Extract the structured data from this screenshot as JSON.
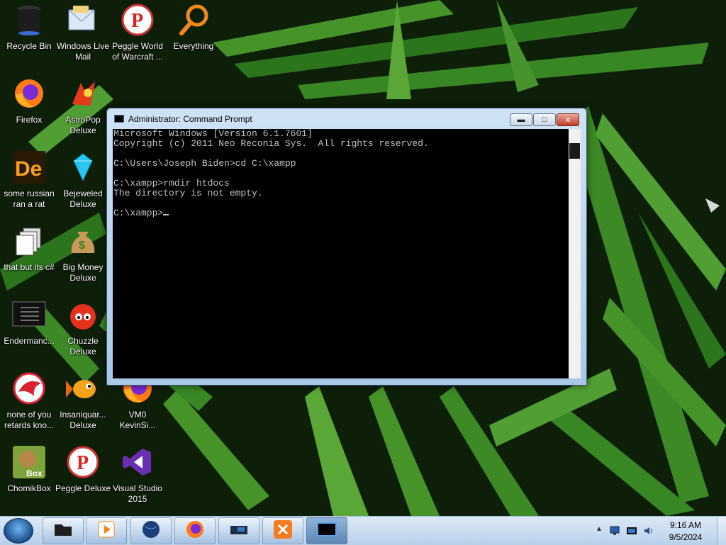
{
  "desktop": {
    "icons": [
      {
        "label": "Recycle Bin",
        "icon": "recycle-bin-icon"
      },
      {
        "label": "Windows Live\nMail",
        "icon": "mail-icon"
      },
      {
        "label": "Peggle World\nof Warcraft ...",
        "icon": "peggle-icon"
      },
      {
        "label": "Everything",
        "icon": "magnifier-icon"
      },
      {
        "label": "Firefox",
        "icon": "firefox-icon"
      },
      {
        "label": "AstroPop\nDeluxe",
        "icon": "astropop-icon"
      },
      {
        "label": "some russian\nran a rat",
        "icon": "de-icon"
      },
      {
        "label": "Bejeweled\nDeluxe",
        "icon": "gem-icon"
      },
      {
        "label": "that but its c#",
        "icon": "copy-icon"
      },
      {
        "label": "Big Money\nDeluxe",
        "icon": "money-bag-icon"
      },
      {
        "label": "Endermanc...",
        "icon": "terminal-icon"
      },
      {
        "label": "Chuzzle\nDeluxe",
        "icon": "chuzzle-icon"
      },
      {
        "label": "none of you\nretards kno...",
        "icon": "dragon-icon"
      },
      {
        "label": "Insaniquar...\nDeluxe",
        "icon": "fish-icon"
      },
      {
        "label": "VM0\nKevinSi...",
        "icon": "firefox-icon"
      },
      {
        "label": "ChomikBox",
        "icon": "hamster-icon"
      },
      {
        "label": "Peggle Deluxe",
        "icon": "peggle-icon"
      },
      {
        "label": "Visual Studio\n2015",
        "icon": "visual-studio-icon"
      }
    ]
  },
  "cmd": {
    "title": "Administrator: Command Prompt",
    "output": "Microsoft Windows [Version 6.1.7601]\nCopyright (c) 2011 Neo Reconia Sys.  All rights reserved.\n\nC:\\Users\\Joseph Biden>cd C:\\xampp\n\nC:\\xampp>rmdir htdocs\nThe directory is not empty.\n\nC:\\xampp>",
    "buttons": {
      "minimize": "▬",
      "maximize": "□",
      "close": "✕"
    }
  },
  "taskbar": {
    "items": [
      {
        "icon": "explorer-icon"
      },
      {
        "icon": "media-player-icon"
      },
      {
        "icon": "globe-icon"
      },
      {
        "icon": "firefox-icon"
      },
      {
        "icon": "device-icon"
      },
      {
        "icon": "xampp-icon"
      },
      {
        "icon": "cmd-icon"
      }
    ],
    "tray": {
      "time": "9:16 AM",
      "date": "9/5/2024"
    }
  },
  "colors": {
    "cmd_text": "#c0c0c0",
    "cmd_bg": "#000000",
    "taskbar": "#c9dcf0",
    "xampp": "#f47b20"
  }
}
